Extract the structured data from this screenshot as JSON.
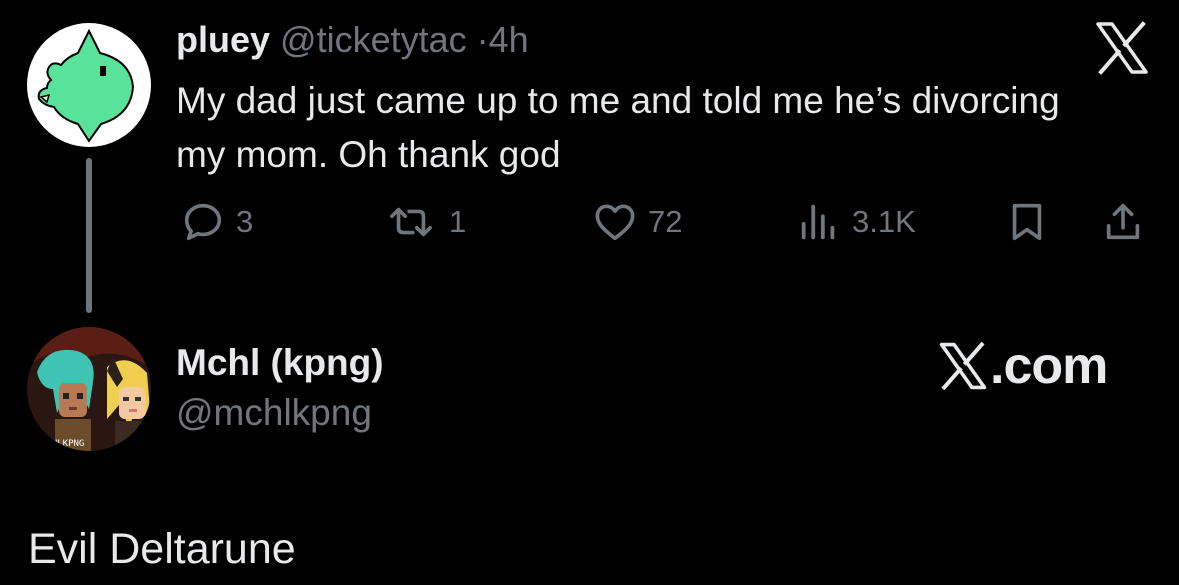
{
  "tweet": {
    "author": {
      "display_name": "pluey",
      "handle": "@ticketytac",
      "separator": "·",
      "time": "4h",
      "avatar_icon": "green-creature-avatar"
    },
    "text": "My dad just came up to me and told me he’s divorcing my mom. Oh thank god",
    "logo_icon": "x-logo-icon",
    "actions": {
      "replies": "3",
      "reposts": "1",
      "likes": "72",
      "views": "3.1K"
    }
  },
  "quote_account": {
    "display_name": "Mchl (kpng)",
    "handle": "@mchlkpng",
    "avatar_watermark": "MCHLKPNG",
    "brand_text": ".com",
    "brand_icon": "x-logo-icon"
  },
  "caption": "Evil Deltarune",
  "colors": {
    "background": "#000000",
    "text": "#e7e9ea",
    "muted": "#71767b",
    "avatar_green": "#59e39a",
    "thread_line": "#6e767d"
  }
}
